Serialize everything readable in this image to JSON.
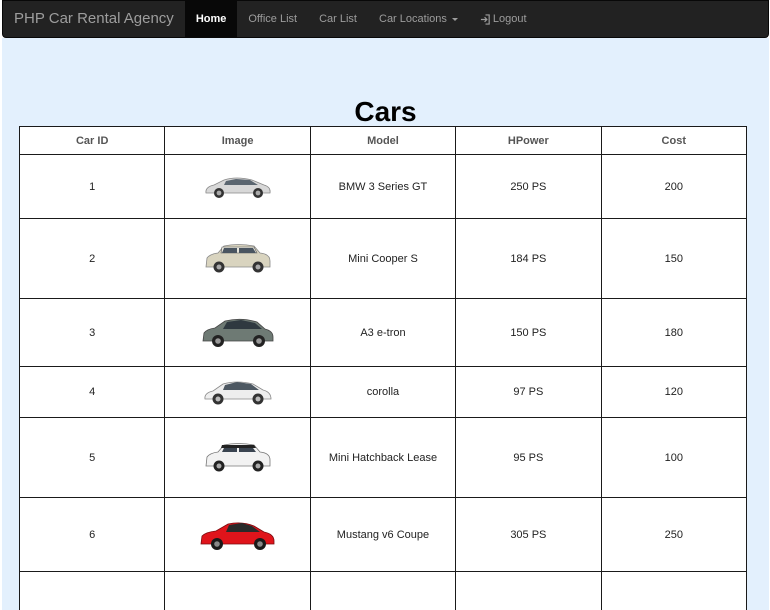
{
  "navbar": {
    "brand": "PHP Car Rental Agency",
    "items": [
      {
        "label": "Home",
        "active": true
      },
      {
        "label": "Office List"
      },
      {
        "label": "Car List"
      },
      {
        "label": "Car Locations",
        "dropdown": true
      },
      {
        "label": "Logout",
        "icon": "log-in-icon"
      }
    ]
  },
  "page": {
    "title": "Cars"
  },
  "table": {
    "headers": [
      "Car ID",
      "Image",
      "Model",
      "HPower",
      "Cost"
    ],
    "rows": [
      {
        "id": "1",
        "image": "bmw-sedan-silver",
        "model": "BMW 3 Series GT",
        "hpower": "250 PS",
        "cost": "200"
      },
      {
        "id": "2",
        "image": "mini-cooper-cream",
        "model": "Mini Cooper S",
        "hpower": "184 PS",
        "cost": "150"
      },
      {
        "id": "3",
        "image": "audi-hatchback-grey",
        "model": "A3 e-tron",
        "hpower": "150 PS",
        "cost": "180"
      },
      {
        "id": "4",
        "image": "corolla-sedan-white",
        "model": "corolla",
        "hpower": "97 PS",
        "cost": "120"
      },
      {
        "id": "5",
        "image": "mini-hatchback-white",
        "model": "Mini Hatchback Lease",
        "hpower": "95 PS",
        "cost": "100"
      },
      {
        "id": "6",
        "image": "mustang-coupe-red",
        "model": "Mustang v6 Coupe",
        "hpower": "305 PS",
        "cost": "250"
      }
    ]
  },
  "colors": {
    "navbar_bg": "#222222",
    "content_bg": "#e3f0fd",
    "car_colors": [
      "#d8d8d8",
      "#d9d4bf",
      "#6e7a74",
      "#eeeeee",
      "#f2f2f2",
      "#e0141b"
    ]
  }
}
